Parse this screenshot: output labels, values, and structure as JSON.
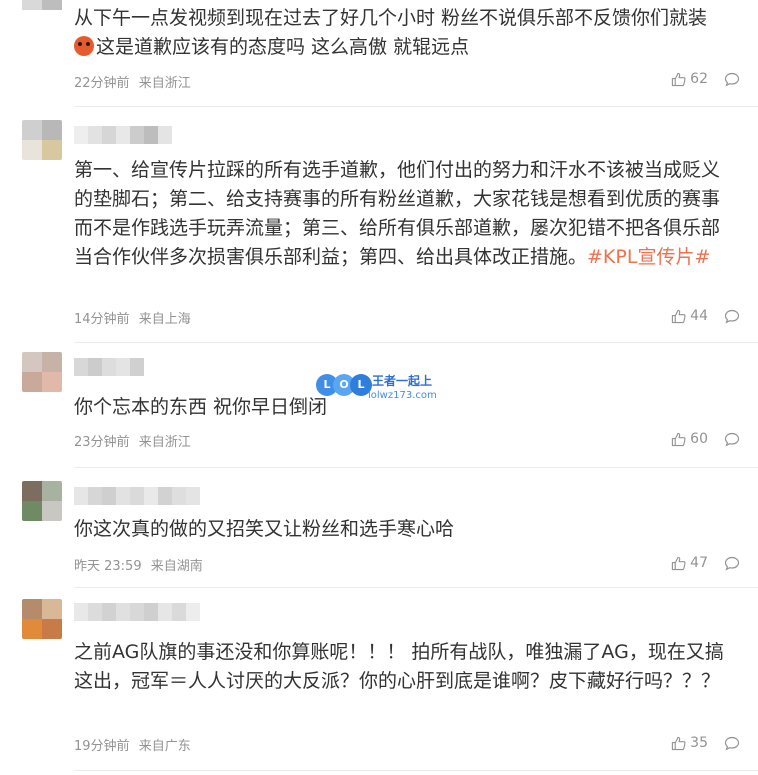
{
  "comments": [
    {
      "text_line1": "从下午一点发视频到现在过去了好几个小时 粉丝不说俱乐部不反馈你们就装",
      "text_line2": "这是道歉应该有的态度吗 这么高傲 就辊远点",
      "emoji_icon": "angry-face-icon",
      "time": "22分钟前",
      "location": "来自浙江",
      "likes": "62"
    },
    {
      "text": "第一、给宣传片拉踩的所有选手道歉，他们付出的努力和汗水不该被当成贬义的垫脚石；第二、给支持赛事的所有粉丝道歉，大家花钱是想看到优质的赛事而不是作践选手玩弄流量；第三、给所有俱乐部道歉，屡次犯错不把各俱乐部当合作伙伴多次损害俱乐部利益；第四、给出具体改正措施。",
      "topic": "#KPL宣传片#",
      "time": "14分钟前",
      "location": "来自上海",
      "likes": "44"
    },
    {
      "text": "你个忘本的东西 祝你早日倒闭",
      "time": "23分钟前",
      "location": "来自浙江",
      "likes": "60"
    },
    {
      "text": "你这次真的做的又招笑又让粉丝和选手寒心哈",
      "time": "昨天 23:59",
      "location": "来自湖南",
      "likes": "47"
    },
    {
      "text": "之前AG队旗的事还没和你算账呢！！！ 拍所有战队，唯独漏了AG，现在又搞这出，冠军＝人人讨厌的大反派？你的心肝到底是谁啊？皮下藏好行吗？？？",
      "time": "19分钟前",
      "location": "来自广东",
      "likes": "35"
    }
  ],
  "watermark": {
    "logo_letters": [
      "L",
      "O",
      "L"
    ],
    "title": "王者一起上",
    "url": "lolwz173.com"
  },
  "colors": {
    "text": "#333333",
    "meta": "#939393",
    "topic": "#eb7350",
    "divider": "#ececec"
  }
}
